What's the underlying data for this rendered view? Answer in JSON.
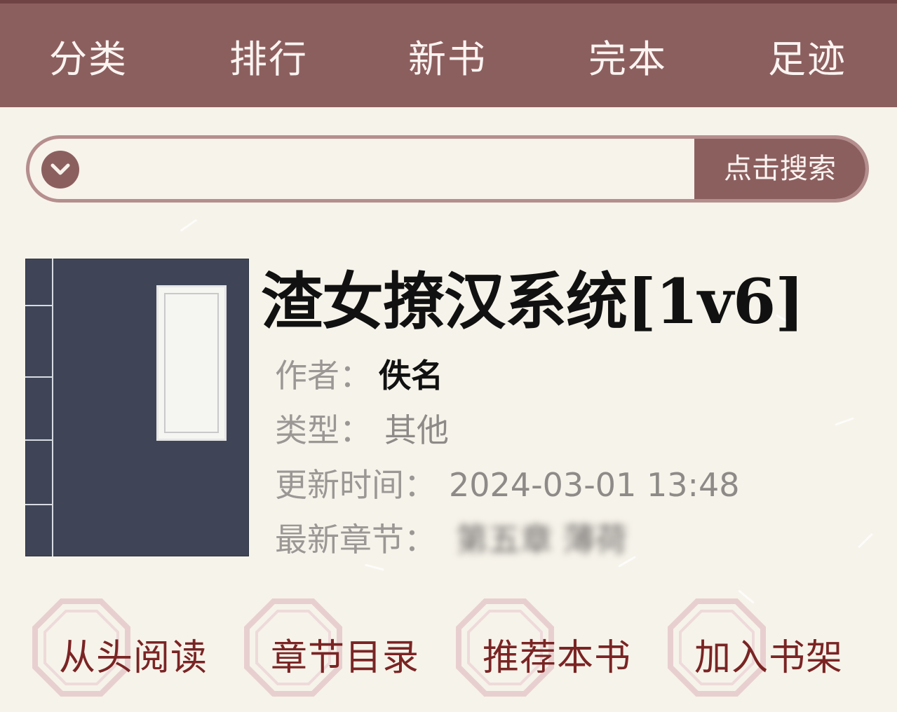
{
  "nav": [
    "分类",
    "排行",
    "新书",
    "完本",
    "足迹"
  ],
  "search": {
    "value": "",
    "button_label": "点击搜索"
  },
  "book": {
    "title": "渣女撩汉系统[1v6]",
    "author_label": "作者：",
    "author": "佚名",
    "type_label": "类型：",
    "type": "其他",
    "updated_label": "更新时间：",
    "updated": "2024-03-01 13:48",
    "latest_label": "最新章节：",
    "latest_chapter": "第五章 薄荷"
  },
  "actions": [
    "从头阅读",
    "章节目录",
    "推荐本书",
    "加入书架"
  ],
  "colors": {
    "brand": "#8c5f5f",
    "action_text": "#7a2424",
    "background": "#f6f3ea"
  }
}
